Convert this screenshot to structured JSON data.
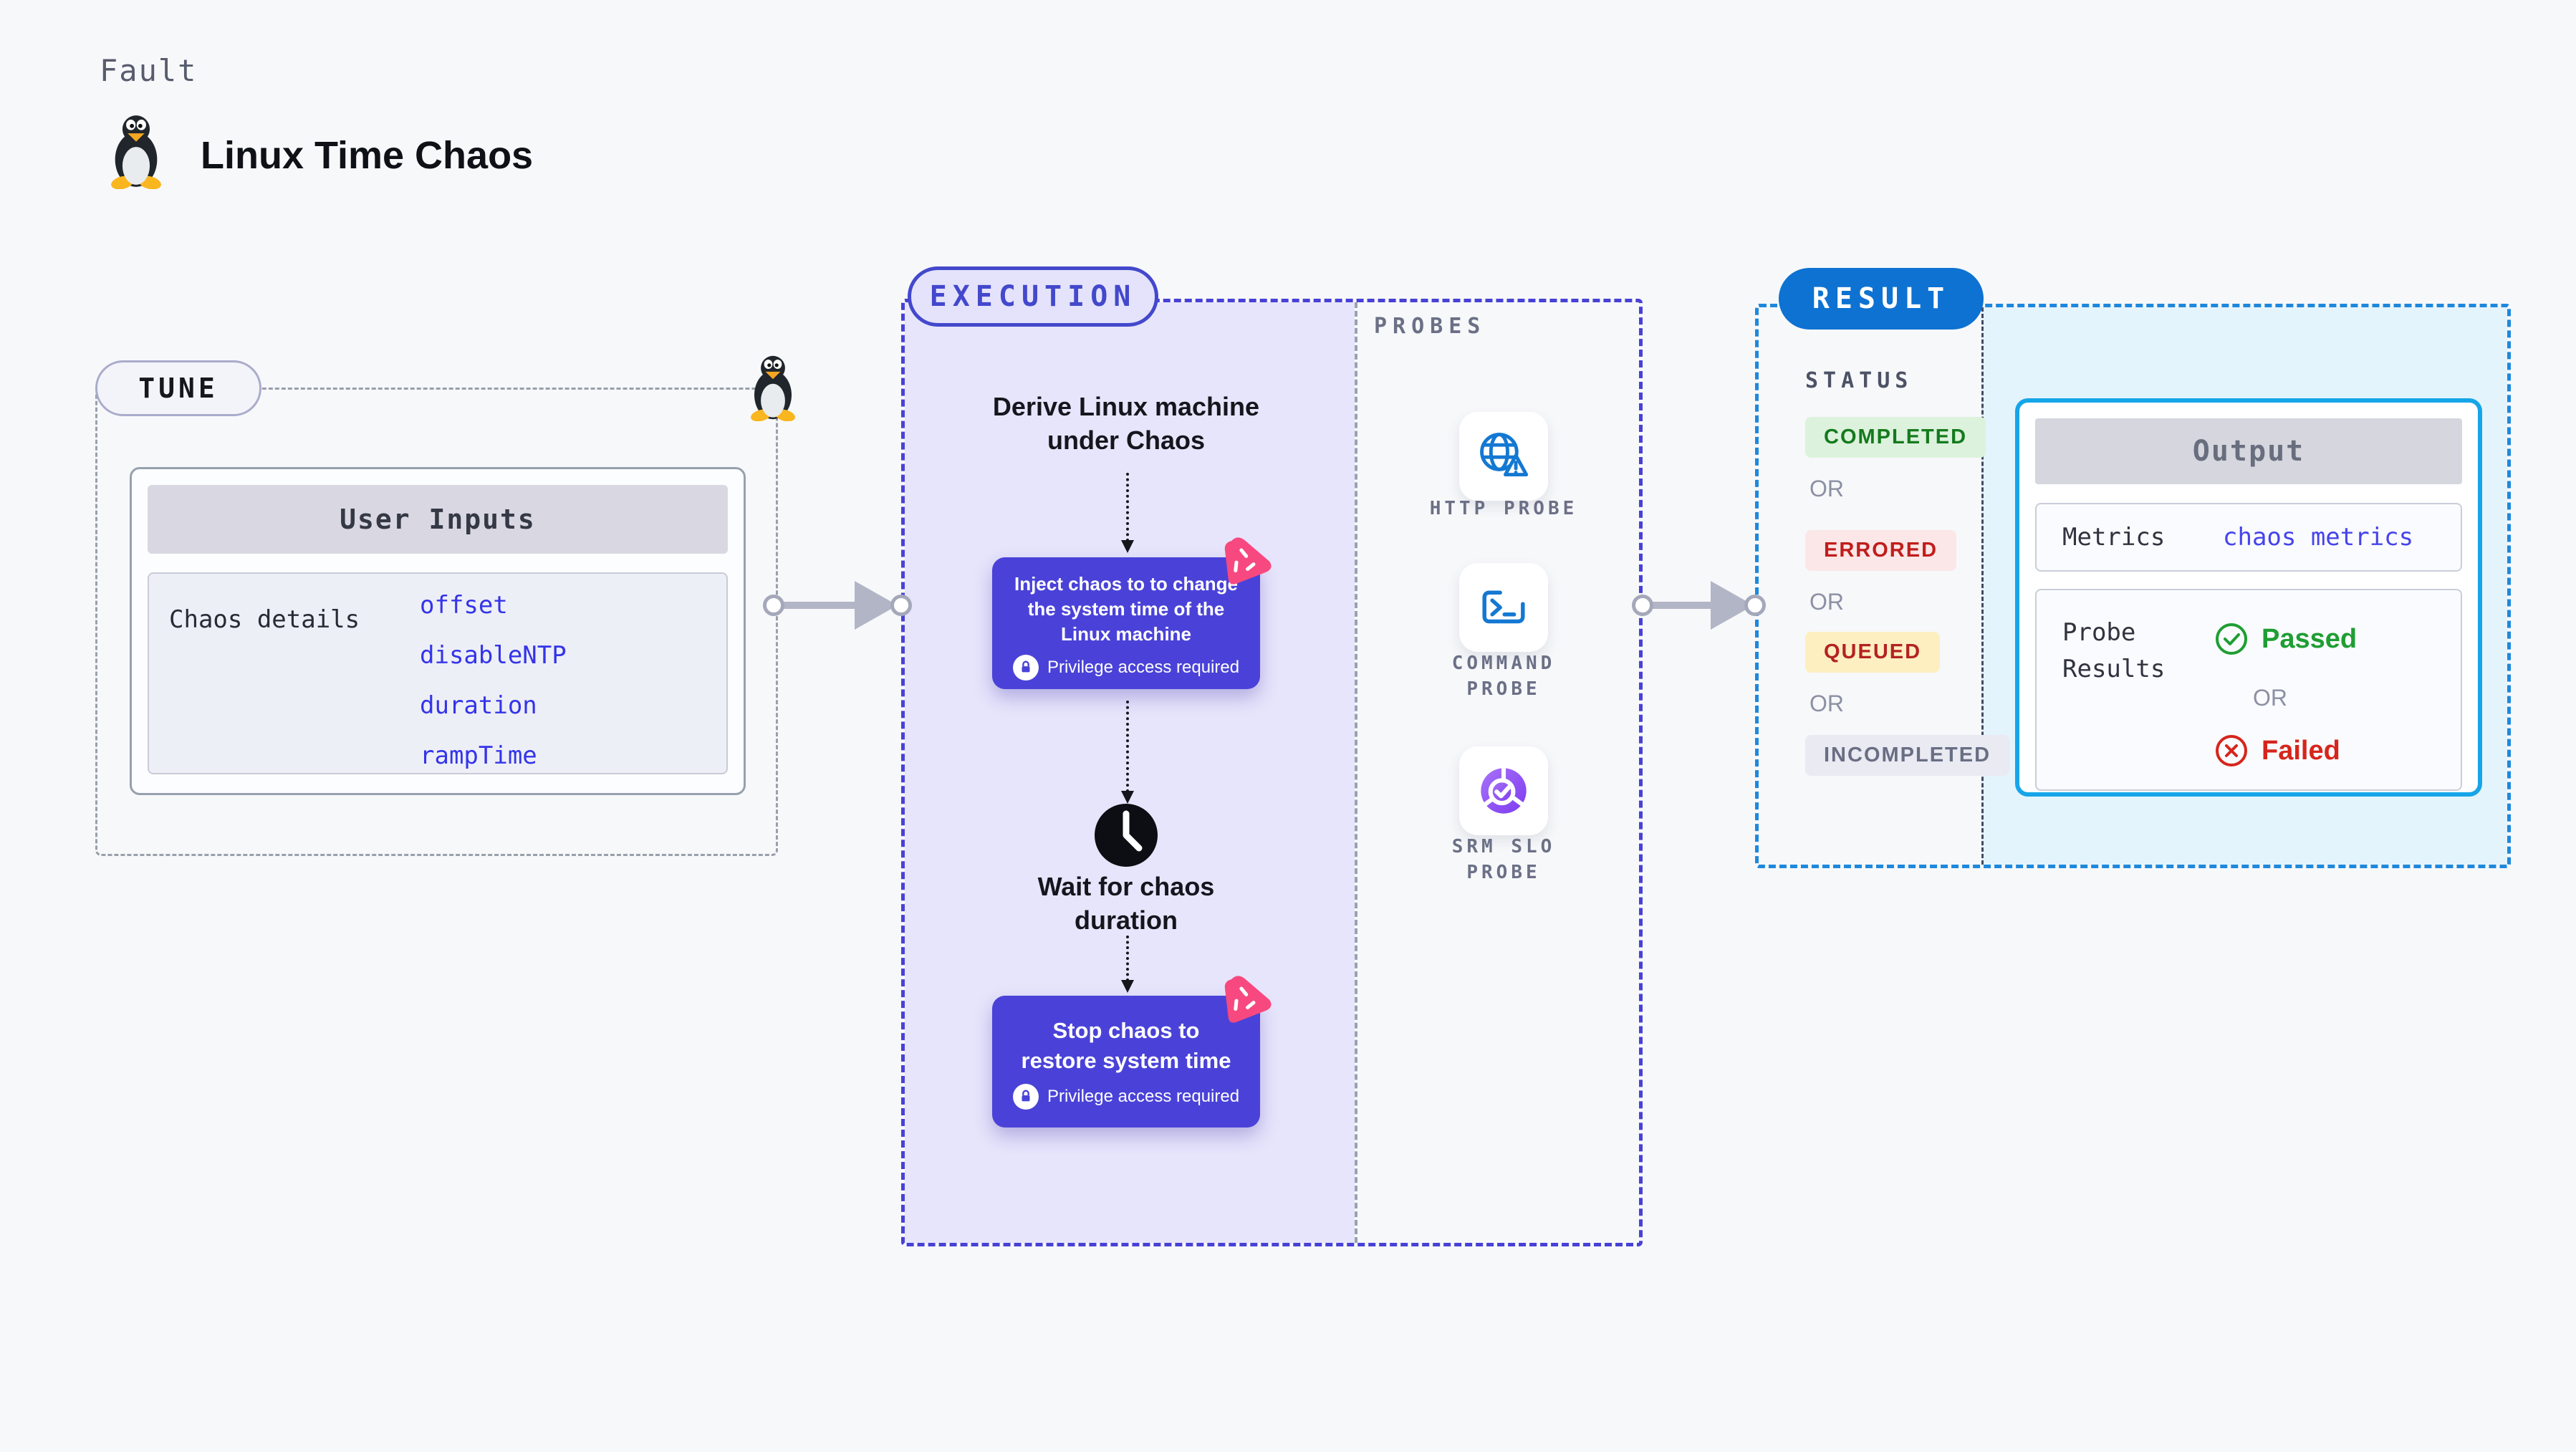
{
  "page": {
    "kicker": "Fault",
    "title": "Linux Time Chaos"
  },
  "colors": {
    "accent_indigo": "#4a42d8",
    "execution_fill": "#e7e5fb",
    "chaos_pink": "#f7497f",
    "result_blue": "#0d72d2",
    "output_border": "#16a5e8",
    "probe_blue": "#1478d2",
    "srm_purple": "#7c3bf0",
    "passed_green": "#1e9e33",
    "failed_red": "#d6251c",
    "param_blue": "#3434ea"
  },
  "tune": {
    "label": "TUNE",
    "card": {
      "title": "User Inputs",
      "row_label": "Chaos details",
      "params": [
        "offset",
        "disableNTP",
        "duration",
        "rampTime"
      ]
    }
  },
  "execution": {
    "label": "EXECUTION",
    "derive_lines": [
      "Derive Linux machine",
      "under Chaos"
    ],
    "inject_lines": [
      "Inject chaos to to change",
      "the system time of the",
      "Linux machine"
    ],
    "wait_lines": [
      "Wait for chaos",
      "duration"
    ],
    "stop_lines": [
      "Stop chaos to",
      "restore system time"
    ],
    "privilege_label": "Privilege access required"
  },
  "probes": {
    "label": "PROBES",
    "items": [
      {
        "name": "HTTP PROBE",
        "icon": "globe-warning-icon"
      },
      {
        "name": "COMMAND PROBE",
        "icon": "terminal-icon"
      },
      {
        "name": "SRM SLO PROBE",
        "icon": "slo-pie-check-icon"
      }
    ]
  },
  "result": {
    "label": "RESULT",
    "status_label": "STATUS",
    "or_label": "OR",
    "statuses": [
      {
        "label": "COMPLETED",
        "bg": "#dcf2dc",
        "color": "#157a1e"
      },
      {
        "label": "ERRORED",
        "bg": "#fbe7e7",
        "color": "#c01d1d"
      },
      {
        "label": "QUEUED",
        "bg": "#fdefc0",
        "color": "#b42222"
      },
      {
        "label": "INCOMPLETED",
        "bg": "#e9eaf2",
        "color": "#696e84"
      }
    ],
    "output": {
      "title": "Output",
      "metrics_label": "Metrics",
      "metrics_value": "chaos metrics",
      "probe_results_label": "Probe Results",
      "passed_label": "Passed",
      "failed_label": "Failed"
    }
  }
}
